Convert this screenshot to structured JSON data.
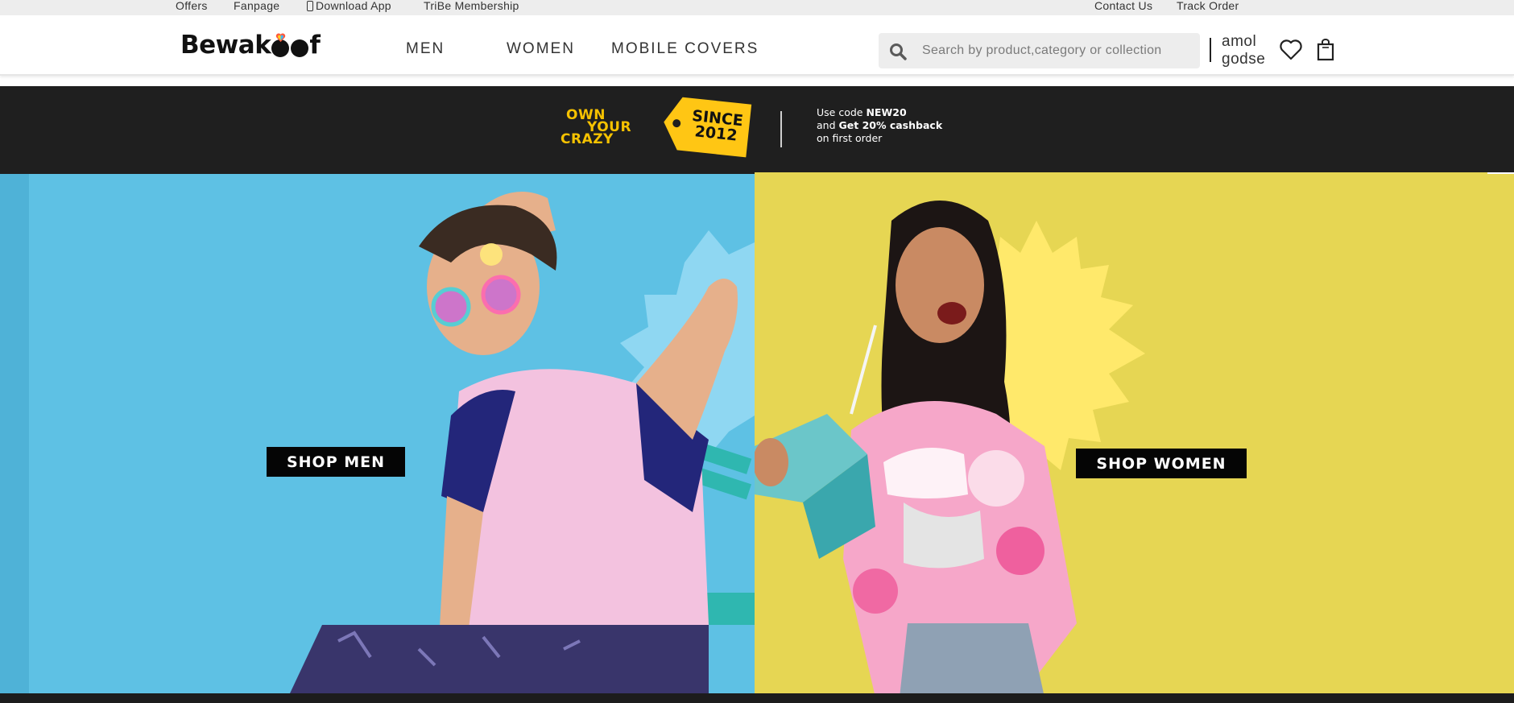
{
  "topbar": {
    "offers": "Offers",
    "fanpage": "Fanpage",
    "download_app": "Download App",
    "tribe": "TriBe Membership",
    "contact": "Contact Us",
    "track": "Track Order"
  },
  "header": {
    "logo_text_left": "Bewak",
    "logo_text_right": "f",
    "nav": [
      "MEN",
      "WOMEN",
      "MOBILE COVERS"
    ],
    "search_placeholder": "Search by product,category or collection",
    "user_first": "amol",
    "user_last": "godse",
    "icons": [
      "search-icon",
      "heart-icon",
      "bag-icon"
    ]
  },
  "promo": {
    "own_lines": [
      "OWN",
      "YOUR",
      "CRAZY"
    ],
    "tag_lines": [
      "SINCE",
      "2012"
    ],
    "code_prefix": "Use code ",
    "code": "NEW20",
    "cashback_prefix": "and ",
    "cashback": "Get 20% cashback",
    "first_order": "on first order"
  },
  "hero": {
    "shop_men": "SHOP MEN",
    "shop_women": "SHOP WOMEN"
  },
  "colors": {
    "accent_yellow": "#f6c200",
    "men_bg": "#5ec1e4",
    "women_bg": "#e6d653",
    "dark_strip": "#1f1f1f"
  }
}
